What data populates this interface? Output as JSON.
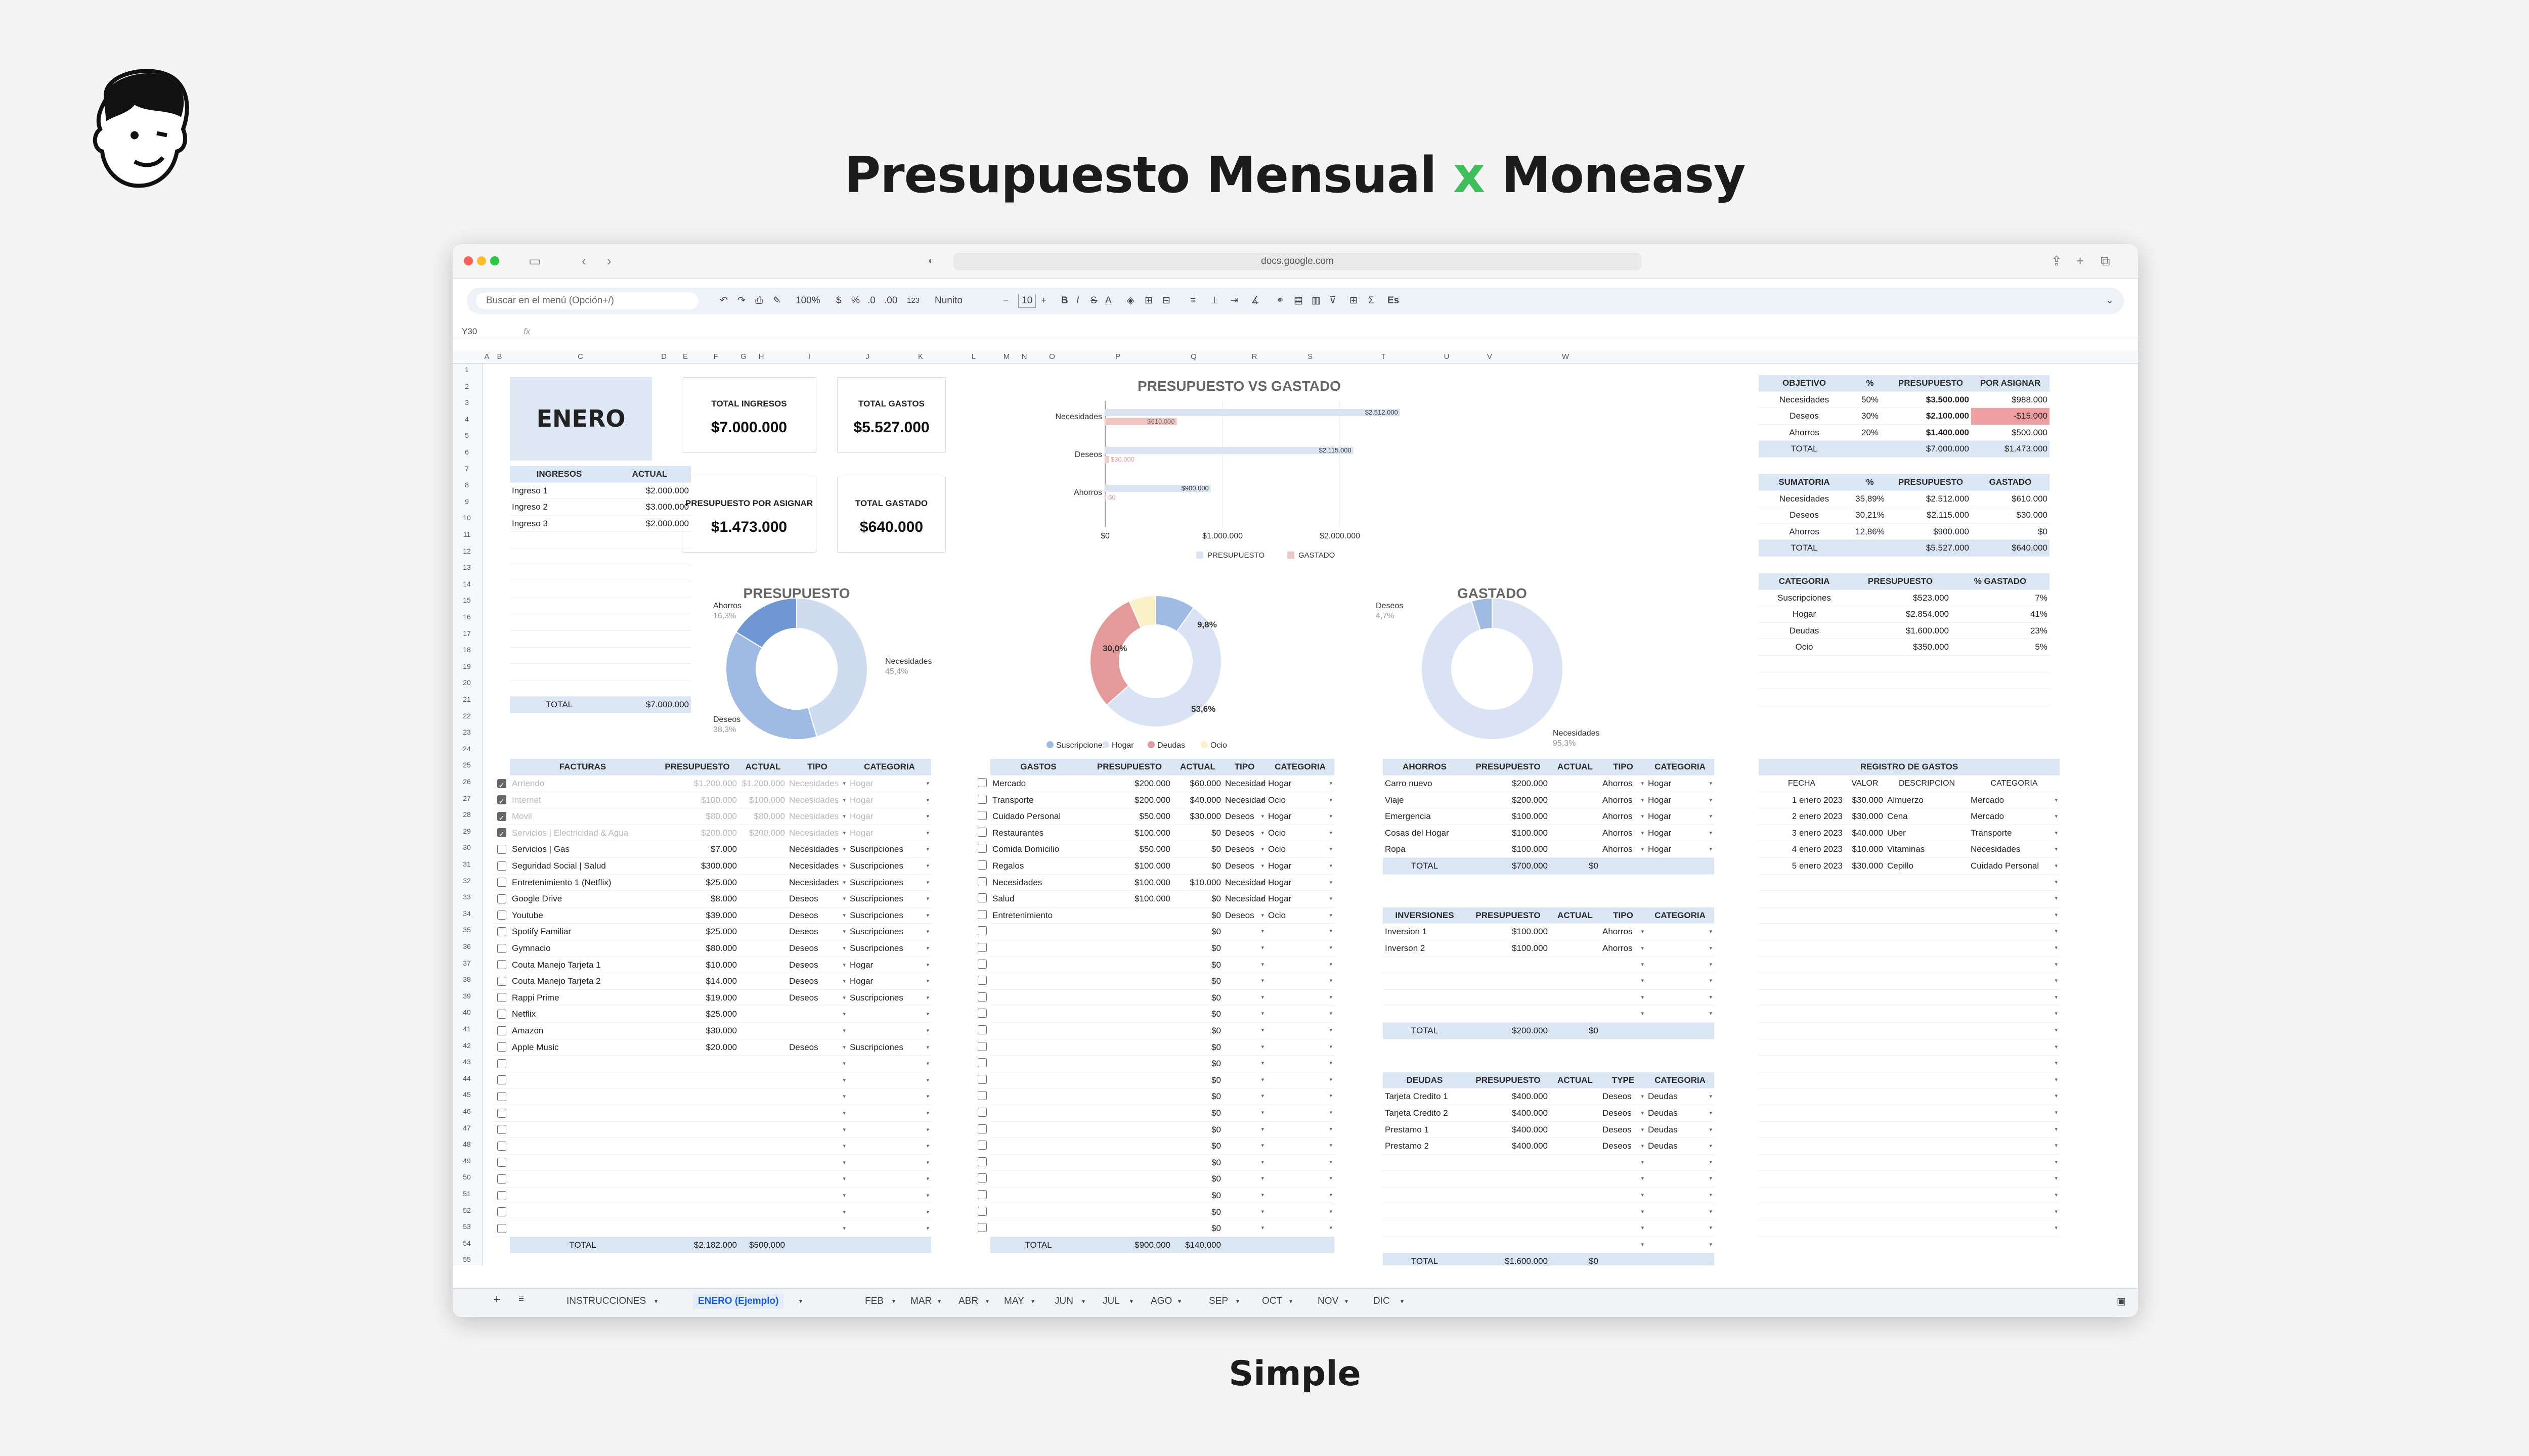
{
  "hero": {
    "prefix": "Presupuesto Mensual ",
    "x": "x",
    "suffix": " Moneasy",
    "caption": "Simple"
  },
  "browser": {
    "url": "docs.google.com"
  },
  "toolbar": {
    "search_placeholder": "Buscar en el menú (Opción+/)",
    "zoom": "100%",
    "currency": "$",
    "percent": "%",
    "dec_less": ".0",
    "dec_more": ".00",
    "num_format": "123",
    "font": "Nunito",
    "font_size": "10",
    "cell_ref": "Y30",
    "fx": "fx"
  },
  "columns": [
    "A",
    "B",
    "C",
    "D",
    "E",
    "F",
    "G",
    "H",
    "I",
    "J",
    "K",
    "L",
    "M",
    "N",
    "O",
    "P",
    "Q",
    "R",
    "S",
    "T",
    "U",
    "V",
    "W"
  ],
  "month_title": "ENERO",
  "summary": {
    "total_ingresos_label": "TOTAL INGRESOS",
    "total_ingresos": "$7.000.000",
    "total_gastos_label": "TOTAL GASTOS",
    "total_gastos": "$5.527.000",
    "por_asignar_label": "PRESUPUESTO POR ASIGNAR",
    "por_asignar": "$1.473.000",
    "total_gastado_label": "TOTAL GASTADO",
    "total_gastado": "$640.000"
  },
  "ingresos": {
    "headers": [
      "INGRESOS",
      "ACTUAL"
    ],
    "rows": [
      [
        "Ingreso 1",
        "$2.000.000"
      ],
      [
        "Ingreso 2",
        "$3.000.000"
      ],
      [
        "Ingreso 3",
        "$2.000.000"
      ]
    ],
    "total_label": "TOTAL",
    "total": "$7.000.000"
  },
  "objetivo": {
    "headers": [
      "OBJETIVO",
      "%",
      "PRESUPUESTO",
      "POR ASIGNAR"
    ],
    "rows": [
      [
        "Necesidades",
        "50%",
        "$3.500.000",
        "$988.000"
      ],
      [
        "Deseos",
        "30%",
        "$2.100.000",
        "-$15.000"
      ],
      [
        "Ahorros",
        "20%",
        "$1.400.000",
        "$500.000"
      ]
    ],
    "total": [
      "TOTAL",
      "",
      "$7.000.000",
      "$1.473.000"
    ]
  },
  "sumatoria": {
    "headers": [
      "SUMATORIA",
      "%",
      "PRESUPUESTO",
      "GASTADO"
    ],
    "rows": [
      [
        "Necesidades",
        "35,89%",
        "$2.512.000",
        "$610.000"
      ],
      [
        "Deseos",
        "30,21%",
        "$2.115.000",
        "$30.000"
      ],
      [
        "Ahorros",
        "12,86%",
        "$900.000",
        "$0"
      ]
    ],
    "total": [
      "TOTAL",
      "",
      "$5.527.000",
      "$640.000"
    ]
  },
  "categoria": {
    "headers": [
      "CATEGORIA",
      "PRESUPUESTO",
      "% GASTADO"
    ],
    "rows": [
      [
        "Suscripciones",
        "$523.000",
        "7%"
      ],
      [
        "Hogar",
        "$2.854.000",
        "41%"
      ],
      [
        "Deudas",
        "$1.600.000",
        "23%"
      ],
      [
        "Ocio",
        "$350.000",
        "5%"
      ]
    ]
  },
  "chart_data": [
    {
      "type": "bar",
      "title": "PRESUPUESTO VS GASTADO",
      "categories": [
        "Necesidades",
        "Deseos",
        "Ahorros"
      ],
      "series": [
        {
          "name": "PRESUPUESTO",
          "values": [
            2512000,
            2115000,
            900000
          ],
          "labels": [
            "$2.512.000",
            "$2.115.000",
            "$900.000"
          ],
          "color": "#dbe4f3"
        },
        {
          "name": "GASTADO",
          "values": [
            610000,
            30000,
            0
          ],
          "labels": [
            "$610.000",
            "$30.000",
            "$0"
          ],
          "color": "#f3c6c6"
        }
      ],
      "xticks": [
        "$0",
        "$1.000.000",
        "$2.000.000"
      ],
      "xlim": [
        0,
        2500000
      ],
      "orientation": "horizontal"
    },
    {
      "type": "pie",
      "title": "PRESUPUESTO",
      "donut": true,
      "labels": [
        "Necesidades",
        "Deseos",
        "Ahorros"
      ],
      "values": [
        45.4,
        38.3,
        16.3
      ],
      "label_text": [
        "45,4%",
        "38,3%",
        "16,3%"
      ],
      "colors": [
        "#cfdcf0",
        "#9fbbe3",
        "#6f97d4"
      ]
    },
    {
      "type": "pie",
      "title": "",
      "donut": true,
      "labels": [
        "Suscripciones",
        "Hogar",
        "Deudas",
        "Ocio"
      ],
      "values": [
        9.8,
        53.6,
        30.0,
        6.6
      ],
      "label_text": [
        "9,8%",
        "53,6%",
        "30,0%",
        ""
      ],
      "colors": [
        "#9fbbe3",
        "#d9e3f3",
        "#e59a9a",
        "#fbf1c7"
      ]
    },
    {
      "type": "pie",
      "title": "GASTADO",
      "donut": true,
      "labels": [
        "Necesidades",
        "Deseos"
      ],
      "values": [
        95.3,
        4.7
      ],
      "label_text": [
        "95,3%",
        "4,7%"
      ],
      "colors": [
        "#d9e3f3",
        "#9fbbe3"
      ]
    }
  ],
  "facturas": {
    "headers": [
      "FACTURAS",
      "PRESUPUESTO",
      "ACTUAL",
      "TIPO",
      "CATEGORIA"
    ],
    "rows": [
      {
        "checked": true,
        "name": "Arriendo",
        "p": "$1.200.000",
        "a": "$1.200.000",
        "t": "Necesidades",
        "c": "Hogar"
      },
      {
        "checked": true,
        "name": "Internet",
        "p": "$100.000",
        "a": "$100.000",
        "t": "Necesidades",
        "c": "Hogar"
      },
      {
        "checked": true,
        "name": "Movil",
        "p": "$80.000",
        "a": "$80.000",
        "t": "Necesidades",
        "c": "Hogar"
      },
      {
        "checked": true,
        "name": "Servicios | Electricidad & Agua",
        "p": "$200.000",
        "a": "$200.000",
        "t": "Necesidades",
        "c": "Hogar"
      },
      {
        "checked": false,
        "name": "Servicios | Gas",
        "p": "$7.000",
        "a": "",
        "t": "Necesidades",
        "c": "Suscripciones"
      },
      {
        "checked": false,
        "name": "Seguridad Social | Salud",
        "p": "$300.000",
        "a": "",
        "t": "Necesidades",
        "c": "Suscripciones"
      },
      {
        "checked": false,
        "name": "Entretenimiento 1 (Netflix)",
        "p": "$25.000",
        "a": "",
        "t": "Necesidades",
        "c": "Suscripciones"
      },
      {
        "checked": false,
        "name": "Google Drive",
        "p": "$8.000",
        "a": "",
        "t": "Deseos",
        "c": "Suscripciones"
      },
      {
        "checked": false,
        "name": "Youtube",
        "p": "$39.000",
        "a": "",
        "t": "Deseos",
        "c": "Suscripciones"
      },
      {
        "checked": false,
        "name": "Spotify Familiar",
        "p": "$25.000",
        "a": "",
        "t": "Deseos",
        "c": "Suscripciones"
      },
      {
        "checked": false,
        "name": "Gymnacio",
        "p": "$80.000",
        "a": "",
        "t": "Deseos",
        "c": "Suscripciones"
      },
      {
        "checked": false,
        "name": "Couta Manejo Tarjeta 1",
        "p": "$10.000",
        "a": "",
        "t": "Deseos",
        "c": "Hogar"
      },
      {
        "checked": false,
        "name": "Couta Manejo Tarjeta 2",
        "p": "$14.000",
        "a": "",
        "t": "Deseos",
        "c": "Hogar"
      },
      {
        "checked": false,
        "name": "Rappi Prime",
        "p": "$19.000",
        "a": "",
        "t": "Deseos",
        "c": "Suscripciones"
      },
      {
        "checked": false,
        "name": "Netflix",
        "p": "$25.000",
        "a": "",
        "t": "",
        "c": ""
      },
      {
        "checked": false,
        "name": "Amazon",
        "p": "$30.000",
        "a": "",
        "t": "",
        "c": ""
      },
      {
        "checked": false,
        "name": "Apple Music",
        "p": "$20.000",
        "a": "",
        "t": "Deseos",
        "c": "Suscripciones"
      }
    ],
    "total": [
      "TOTAL",
      "$2.182.000",
      "$500.000"
    ]
  },
  "gastos": {
    "headers": [
      "GASTOS",
      "PRESUPUESTO",
      "ACTUAL",
      "TIPO",
      "CATEGORIA"
    ],
    "rows": [
      [
        "Mercado",
        "$200.000",
        "$60.000",
        "Necesidades",
        "Hogar"
      ],
      [
        "Transporte",
        "$200.000",
        "$40.000",
        "Necesidades",
        "Ocio"
      ],
      [
        "Cuidado Personal",
        "$50.000",
        "$30.000",
        "Deseos",
        "Hogar"
      ],
      [
        "Restaurantes",
        "$100.000",
        "$0",
        "Deseos",
        "Ocio"
      ],
      [
        "Comida Domicilio",
        "$50.000",
        "$0",
        "Deseos",
        "Ocio"
      ],
      [
        "Regalos",
        "$100.000",
        "$0",
        "Deseos",
        "Hogar"
      ],
      [
        "Necesidades",
        "$100.000",
        "$10.000",
        "Necesidades",
        "Hogar"
      ],
      [
        "Salud",
        "$100.000",
        "$0",
        "Necesidades",
        "Hogar"
      ],
      [
        "Entretenimiento",
        "",
        "$0",
        "Deseos",
        "Ocio"
      ]
    ],
    "zero": "$0",
    "total": [
      "TOTAL",
      "$900.000",
      "$140.000"
    ]
  },
  "ahorros": {
    "headers": [
      "AHORROS",
      "PRESUPUESTO",
      "ACTUAL",
      "TIPO",
      "CATEGORIA"
    ],
    "rows": [
      [
        "Carro nuevo",
        "$200.000",
        "",
        "Ahorros",
        "Hogar"
      ],
      [
        "Viaje",
        "$200.000",
        "",
        "Ahorros",
        "Hogar"
      ],
      [
        "Emergencia",
        "$100.000",
        "",
        "Ahorros",
        "Hogar"
      ],
      [
        "Cosas del Hogar",
        "$100.000",
        "",
        "Ahorros",
        "Hogar"
      ],
      [
        "Ropa",
        "$100.000",
        "",
        "Ahorros",
        "Hogar"
      ]
    ],
    "total": [
      "TOTAL",
      "$700.000",
      "$0"
    ]
  },
  "inversiones": {
    "headers": [
      "INVERSIONES",
      "PRESUPUESTO",
      "ACTUAL",
      "TIPO",
      "CATEGORIA"
    ],
    "rows": [
      [
        "Inversion 1",
        "$100.000",
        "",
        "Ahorros",
        ""
      ],
      [
        "Inverson 2",
        "$100.000",
        "",
        "Ahorros",
        ""
      ]
    ],
    "total": [
      "TOTAL",
      "$200.000",
      "$0"
    ]
  },
  "deudas": {
    "headers": [
      "DEUDAS",
      "PRESUPUESTO",
      "ACTUAL",
      "TYPE",
      "CATEGORIA"
    ],
    "rows": [
      [
        "Tarjeta Credito 1",
        "$400.000",
        "",
        "Deseos",
        "Deudas"
      ],
      [
        "Tarjeta Credito 2",
        "$400.000",
        "",
        "Deseos",
        "Deudas"
      ],
      [
        "Prestamo 1",
        "$400.000",
        "",
        "Deseos",
        "Deudas"
      ],
      [
        "Prestamo 2",
        "$400.000",
        "",
        "Deseos",
        "Deudas"
      ]
    ],
    "total": [
      "TOTAL",
      "$1.600.000",
      "$0"
    ]
  },
  "registro": {
    "title": "REGISTRO DE GASTOS",
    "headers": [
      "FECHA",
      "VALOR",
      "DESCRIPCION",
      "CATEGORIA"
    ],
    "rows": [
      [
        "1 enero 2023",
        "$30.000",
        "Almuerzo",
        "Mercado"
      ],
      [
        "2 enero 2023",
        "$30.000",
        "Cena",
        "Mercado"
      ],
      [
        "3 enero 2023",
        "$40.000",
        "Uber",
        "Transporte"
      ],
      [
        "4 enero 2023",
        "$10.000",
        "Vitaminas",
        "Necesidades"
      ],
      [
        "5 enero 2023",
        "$30.000",
        "Cepillo",
        "Cuidado Personal"
      ]
    ]
  },
  "sheet_tabs": [
    "INSTRUCCIONES",
    "ENERO (Ejemplo)",
    "FEB",
    "MAR",
    "ABR",
    "MAY",
    "JUN",
    "JUL",
    "AGO",
    "SEP",
    "OCT",
    "NOV",
    "DIC"
  ],
  "active_tab": "ENERO (Ejemplo)"
}
